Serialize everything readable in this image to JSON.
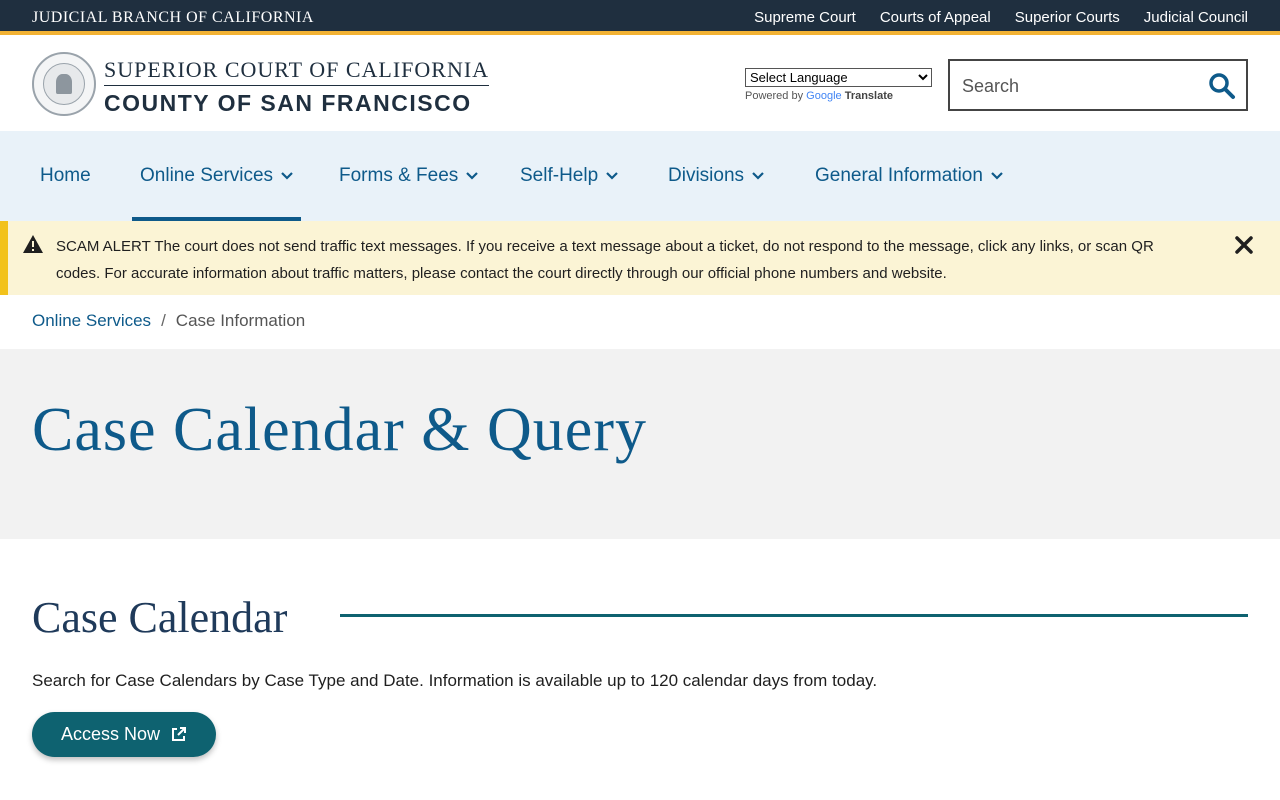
{
  "topbar": {
    "brand": "Judicial Branch of California",
    "links": [
      "Supreme Court",
      "Courts of Appeal",
      "Superior Courts",
      "Judicial Council"
    ]
  },
  "header": {
    "line1": "Superior Court of California",
    "line2": "County of San Francisco",
    "translate": {
      "select_label": "Select Language",
      "powered_by": "Powered by",
      "google": "Google",
      "translate": "Translate"
    },
    "search": {
      "placeholder": "Search",
      "icon": "search-icon"
    }
  },
  "nav": {
    "items": [
      {
        "label": "Home",
        "has_dropdown": false,
        "active": false
      },
      {
        "label": "Online Services",
        "has_dropdown": true,
        "active": true
      },
      {
        "label": "Forms & Fees",
        "has_dropdown": true,
        "active": false
      },
      {
        "label": "Self-Help",
        "has_dropdown": true,
        "active": false
      },
      {
        "label": "Divisions",
        "has_dropdown": true,
        "active": false
      },
      {
        "label": "General Information",
        "has_dropdown": true,
        "active": false
      }
    ]
  },
  "alert": {
    "title": "SCAM ALERT",
    "message": "The court does not send traffic text messages.  If you receive a text message about a ticket, do not respond to the message, click any links, or scan QR codes.  For accurate information about traffic matters, please contact the court directly through our official phone numbers and website.",
    "icon": "warning-icon",
    "close_icon": "close-icon"
  },
  "breadcrumb": {
    "parent": "Online Services",
    "separator": "/",
    "current": "Case Information"
  },
  "hero": {
    "title": "Case Calendar & Query"
  },
  "section": {
    "title": "Case Calendar",
    "description": "Search for Case Calendars by Case Type and Date. Information is available up to 120 calendar days from today.",
    "button": "Access Now",
    "button_icon": "external-link-icon"
  },
  "colors": {
    "topbar": "#1f2f3f",
    "accent_gold": "#f2b233",
    "link_blue": "#0e5a8a",
    "button_teal": "#0e6270",
    "alert_bg": "#fbf4d5"
  }
}
